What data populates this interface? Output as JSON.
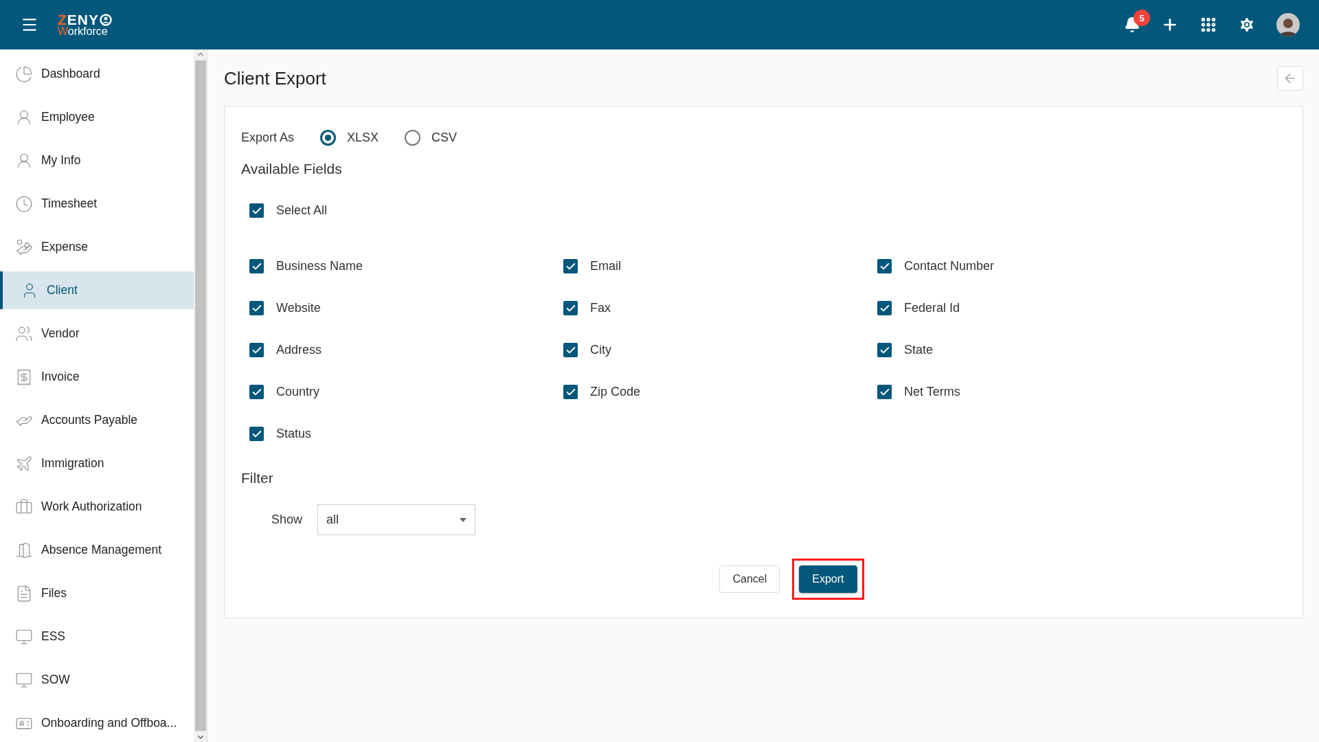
{
  "header": {
    "logo": {
      "top": "ZENY",
      "bottom": "Workforce"
    },
    "notifications": {
      "count": "5"
    }
  },
  "sidebar": {
    "items": [
      {
        "label": "Dashboard",
        "selected": false
      },
      {
        "label": "Employee",
        "selected": false
      },
      {
        "label": "My Info",
        "selected": false
      },
      {
        "label": "Timesheet",
        "selected": false
      },
      {
        "label": "Expense",
        "selected": false
      },
      {
        "label": "Client",
        "selected": true
      },
      {
        "label": "Vendor",
        "selected": false
      },
      {
        "label": "Invoice",
        "selected": false
      },
      {
        "label": "Accounts Payable",
        "selected": false
      },
      {
        "label": "Immigration",
        "selected": false
      },
      {
        "label": "Work Authorization",
        "selected": false
      },
      {
        "label": "Absence Management",
        "selected": false
      },
      {
        "label": "Files",
        "selected": false
      },
      {
        "label": "ESS",
        "selected": false
      },
      {
        "label": "SOW",
        "selected": false
      },
      {
        "label": "Onboarding and Offboa..."
      }
    ]
  },
  "page": {
    "title": "Client Export"
  },
  "export_as": {
    "label": "Export As",
    "options": [
      {
        "label": "XLSX",
        "selected": true
      },
      {
        "label": "CSV",
        "selected": false
      }
    ]
  },
  "available_fields": {
    "heading": "Available Fields",
    "select_all": {
      "label": "Select All",
      "checked": true
    },
    "fields": [
      {
        "label": "Business Name",
        "checked": true
      },
      {
        "label": "Email",
        "checked": true
      },
      {
        "label": "Contact Number",
        "checked": true
      },
      {
        "label": "Website",
        "checked": true
      },
      {
        "label": "Fax",
        "checked": true
      },
      {
        "label": "Federal Id",
        "checked": true
      },
      {
        "label": "Address",
        "checked": true
      },
      {
        "label": "City",
        "checked": true
      },
      {
        "label": "State",
        "checked": true
      },
      {
        "label": "Country",
        "checked": true
      },
      {
        "label": "Zip Code",
        "checked": true
      },
      {
        "label": "Net Terms",
        "checked": true
      },
      {
        "label": "Status",
        "checked": true
      }
    ]
  },
  "filter": {
    "heading": "Filter",
    "show": {
      "label": "Show",
      "value": "all"
    }
  },
  "buttons": [
    {
      "label": "Cancel",
      "kind": "secondary",
      "highlighted": false
    },
    {
      "label": "Export",
      "kind": "primary",
      "highlighted": true
    }
  ]
}
